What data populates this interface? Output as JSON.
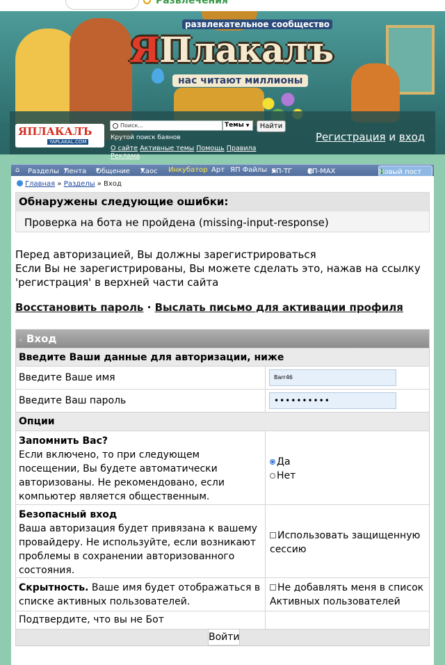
{
  "topbar": {
    "category": "Развлечения"
  },
  "banner": {
    "community_tag": "развлекательное сообщество",
    "logo_ya": "Я",
    "logo_rest": "Плакалъ",
    "slogan": "нас читают миллионы",
    "small_logo": "ЯПЛАКАЛЪ",
    "small_logo_url": "YAPLAKAL.COM"
  },
  "header": {
    "search_placeholder": "Поиск...",
    "topics_select": "Темы",
    "find_button": "Найти",
    "tagline": "Крутой поиск баянов",
    "links": [
      "О сайте",
      "Активные темы",
      "Помощь",
      "Правила",
      "Реклама"
    ],
    "register": "Регистрация",
    "and": "и",
    "login": "вход"
  },
  "nav": {
    "items": [
      "Разделы",
      "Лента",
      "Общение",
      "Хаос",
      "Инкубатор",
      "Арт",
      "ЯП Файлы",
      "ЯП-ТГ",
      "ЯП-MAX"
    ],
    "new_post": "Новый пост"
  },
  "breadcrumb": {
    "home": "Главная",
    "sections": "Разделы",
    "current": "Вход",
    "sep": "»"
  },
  "error": {
    "title": "Обнаружены следующие ошибки:",
    "message": "Проверка на бота не пройдена (missing-input-response)"
  },
  "info": [
    "Перед авторизацией, Вы должны зарегистрироваться",
    "Если Вы не зарегистрированы, Вы можете сделать это, нажав на ссылку",
    "'регистрация' в верхней части сайта"
  ],
  "account_links": {
    "restore": "Восстановить пароль",
    "sep": "·",
    "activation": "Выслать письмо для активации профиля"
  },
  "form": {
    "header": "Вход",
    "subheader": "Введите Ваши данные для авторизации, ниже",
    "username_label": "Введите Ваше имя",
    "username_value": "Barr46",
    "password_label": "Введите Ваш пароль",
    "password_value": "••••••••••",
    "options_title": "Опции",
    "remember_title": "Запомнить Вас?",
    "remember_desc": "Если включено, то при следующем посещении, Вы будете автоматически авторизованы. Не рекомендовано, если компьютер является общественным.",
    "remember_yes": "Да",
    "remember_no": "Нет",
    "secure_title": "Безопасный вход",
    "secure_desc": "Ваша авторизация будет привязана к вашему провайдеру. Не используйте, если возникают проблемы в сохранении авторизованного состояния.",
    "secure_checkbox": "Использовать защищенную сессию",
    "stealth_title": "Скрытность.",
    "stealth_desc": "Ваше имя будет отображаться в списке активных пользователей.",
    "stealth_checkbox": "Не добавлять меня в список Активных пользователей",
    "captcha_label": "Подтвердите, что вы не Бот",
    "submit": "Войти"
  }
}
